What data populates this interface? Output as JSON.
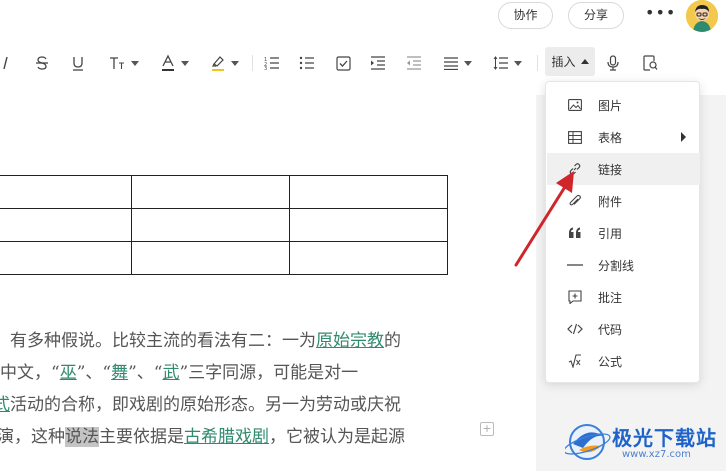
{
  "header": {
    "collab_label": "协作",
    "share_label": "分享",
    "more_label": "•••"
  },
  "toolbar": {
    "insert_label": "插入"
  },
  "insert_menu": {
    "items": [
      {
        "label": "图片",
        "icon": "image-icon"
      },
      {
        "label": "表格",
        "icon": "table-icon",
        "has_submenu": true
      },
      {
        "label": "链接",
        "icon": "link-icon",
        "active": true
      },
      {
        "label": "附件",
        "icon": "paperclip-icon"
      },
      {
        "label": "引用",
        "icon": "quote-icon"
      },
      {
        "label": "分割线",
        "icon": "divider-icon"
      },
      {
        "label": "批注",
        "icon": "comment-icon"
      },
      {
        "label": "代码",
        "icon": "code-icon"
      },
      {
        "label": "公式",
        "icon": "formula-icon"
      }
    ]
  },
  "document": {
    "line1": {
      "a": "有多种假说。比较主流的看法有二：一为",
      "link": "原始宗教",
      "b": "的"
    },
    "line2": {
      "a": "中文，“",
      "l1": "巫",
      "b": "”、“",
      "l2": "舞",
      "c": "”、“",
      "l3": "武",
      "d": "”三字同源，可能是对一"
    },
    "line3": {
      "l": "式",
      "a": "活动的合称，即戏剧的原始形态。另一为劳动或庆祝"
    },
    "line4": {
      "a": "演，这种",
      "hl": "说法",
      "b": "主要依据是",
      "link": "古希腊戏剧",
      "c": "，它被认为是起源"
    }
  },
  "watermark": {
    "text": "极光下载站",
    "url": "www.xz7.com"
  },
  "colors": {
    "link": "#2f8a6e",
    "arrow": "#d0262b",
    "watermark": "#1e63c9"
  }
}
